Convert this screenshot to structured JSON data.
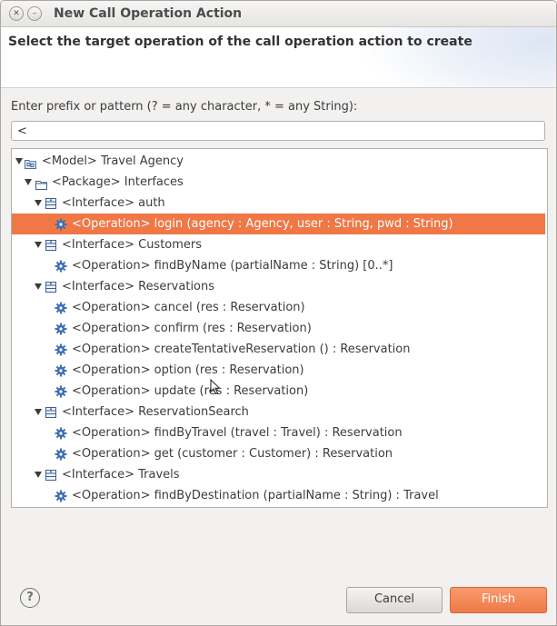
{
  "window": {
    "title": "New Call Operation Action"
  },
  "banner": {
    "title": "Select the target operation of the call operation action to create"
  },
  "filter": {
    "prompt": "Enter prefix or pattern (? = any character, * = any String):",
    "value": "<"
  },
  "tree": {
    "rows": [
      {
        "label": "<Model> Travel Agency",
        "kind": "model",
        "depth": 0,
        "expandable": true,
        "selected": false
      },
      {
        "label": "<Package> Interfaces",
        "kind": "package",
        "depth": 1,
        "expandable": true,
        "selected": false
      },
      {
        "label": "<Interface> auth",
        "kind": "interface",
        "depth": 2,
        "expandable": true,
        "selected": false
      },
      {
        "label": "<Operation> login (agency : Agency, user : String, pwd : String)",
        "kind": "operation",
        "depth": 3,
        "expandable": false,
        "selected": true
      },
      {
        "label": "<Interface> Customers",
        "kind": "interface",
        "depth": 2,
        "expandable": true,
        "selected": false
      },
      {
        "label": "<Operation> findByName (partialName : String) [0..*]",
        "kind": "operation",
        "depth": 3,
        "expandable": false,
        "selected": false
      },
      {
        "label": "<Interface> Reservations",
        "kind": "interface",
        "depth": 2,
        "expandable": true,
        "selected": false
      },
      {
        "label": "<Operation> cancel (res : Reservation)",
        "kind": "operation",
        "depth": 3,
        "expandable": false,
        "selected": false
      },
      {
        "label": "<Operation> confirm (res : Reservation)",
        "kind": "operation",
        "depth": 3,
        "expandable": false,
        "selected": false
      },
      {
        "label": "<Operation> createTentativeReservation () : Reservation",
        "kind": "operation",
        "depth": 3,
        "expandable": false,
        "selected": false
      },
      {
        "label": "<Operation> option (res : Reservation)",
        "kind": "operation",
        "depth": 3,
        "expandable": false,
        "selected": false
      },
      {
        "label": "<Operation> update (res : Reservation)",
        "kind": "operation",
        "depth": 3,
        "expandable": false,
        "selected": false
      },
      {
        "label": "<Interface> ReservationSearch",
        "kind": "interface",
        "depth": 2,
        "expandable": true,
        "selected": false
      },
      {
        "label": "<Operation> findByTravel (travel : Travel) : Reservation",
        "kind": "operation",
        "depth": 3,
        "expandable": false,
        "selected": false
      },
      {
        "label": "<Operation> get (customer : Customer) : Reservation",
        "kind": "operation",
        "depth": 3,
        "expandable": false,
        "selected": false
      },
      {
        "label": "<Interface> Travels",
        "kind": "interface",
        "depth": 2,
        "expandable": true,
        "selected": false
      },
      {
        "label": "<Operation> findByDestination (partialName : String) : Travel",
        "kind": "operation",
        "depth": 3,
        "expandable": false,
        "selected": false
      }
    ]
  },
  "buttons": {
    "cancel": "Cancel",
    "finish": "Finish"
  },
  "icons": {
    "close": "close-icon",
    "minimize": "minimize-icon",
    "help": "help-icon",
    "model": "model-icon",
    "package": "package-icon",
    "interface": "interface-icon",
    "operation": "operation-gear-icon",
    "expand": "expand-triangle-icon"
  },
  "colors": {
    "selection": "#f07746",
    "finish_button": "#ef7a48",
    "accent_blue": "#3f6fb6"
  }
}
